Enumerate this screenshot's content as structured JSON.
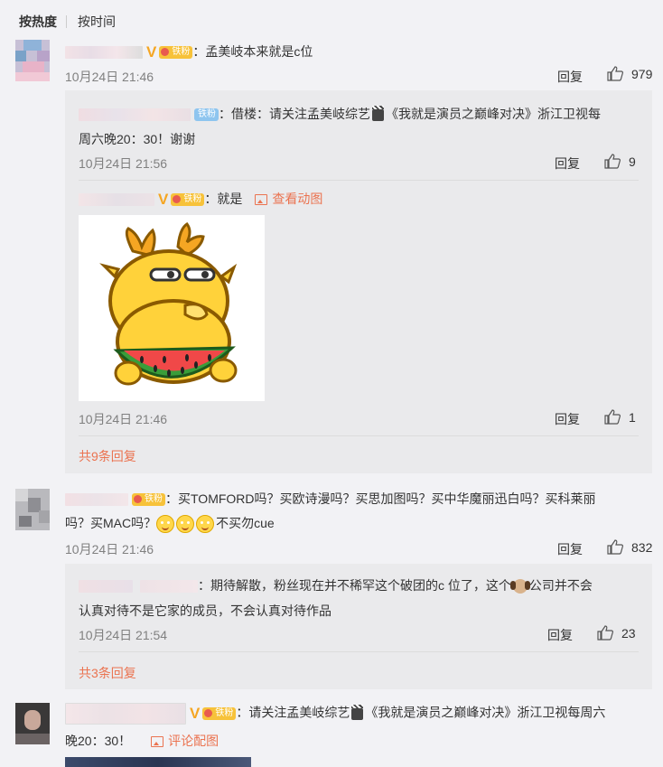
{
  "tabs": {
    "hot": "按热度",
    "time": "按时间"
  },
  "fan_badge": "铁粉",
  "icons": {
    "like": "thumbs-up-icon",
    "image": "image-icon",
    "verified": "verified-v-icon"
  },
  "colors": {
    "accent": "#eb7350",
    "verified": "#f5a623",
    "badge": "#f7c23a"
  },
  "comments": [
    {
      "text": "：孟美岐本来就是c位",
      "time": "10月24日 21:46",
      "reply": "回复",
      "likes": "979",
      "replies": [
        {
          "text_line1": "：借楼：请关注孟美岐综艺",
          "text_line1b": "《我就是演员之巅峰对决》浙江卫视每",
          "text_line2": "周六晚20：30！谢谢",
          "time": "10月24日 21:56",
          "reply": "回复",
          "likes": "9"
        },
        {
          "text": "：就是",
          "link": "查看动图",
          "time": "10月24日 21:46",
          "reply": "回复",
          "likes": "1"
        }
      ],
      "more": "共9条回复"
    },
    {
      "text_line1": "：买TOMFORD吗？买欧诗漫吗？买思加图吗？买中华魔丽迅白吗？买科莱丽",
      "text_line2a": "吗？买MAC吗？",
      "text_line2b": "不买勿cue",
      "time": "10月24日 21:46",
      "reply": "回复",
      "likes": "832",
      "replies": [
        {
          "text_line1a": "：期待解散，粉丝现在并不稀罕这个破团的c 位了，这个",
          "text_line1b": "公司并不会",
          "text_line2": "认真对待不是它家的成员，不会认真对待作品",
          "time": "10月24日 21:54",
          "reply": "回复",
          "likes": "23"
        }
      ],
      "more": "共3条回复"
    },
    {
      "text_line1a": "：请关注孟美岐综艺",
      "text_line1b": "《我就是演员之巅峰对决》浙江卫视每周六",
      "text_line2": "晚20：30！",
      "link": "评论配图"
    }
  ]
}
